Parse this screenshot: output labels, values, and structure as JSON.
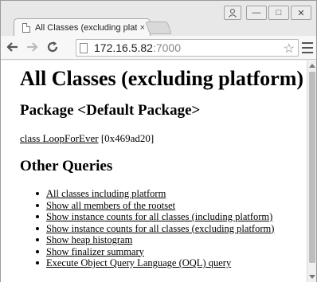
{
  "browser": {
    "tab_title": "All Classes (excluding platf",
    "tab_close": "×",
    "url_host": "172.16.5.82",
    "url_port": ":7000",
    "window_buttons": {
      "minimize": "—",
      "maximize": "□",
      "close": "✕"
    },
    "icons": {
      "back": "back-arrow-icon",
      "forward": "forward-arrow-icon",
      "reload": "reload-icon",
      "star": "bookmark-star-icon",
      "menu": "menu-icon",
      "user": "user-icon"
    }
  },
  "page": {
    "title": "All Classes (excluding platform)",
    "package_heading": "Package <Default Package>",
    "class_link": "class LoopForEver",
    "class_address": " [0x469ad20]",
    "queries_heading": "Other Queries",
    "queries": [
      "All classes including platform",
      "Show all members of the rootset",
      "Show instance counts for all classes (including platform)",
      "Show instance counts for all classes (excluding platform)",
      "Show heap histogram",
      "Show finalizer summary",
      "Execute Object Query Language (OQL) query"
    ]
  }
}
